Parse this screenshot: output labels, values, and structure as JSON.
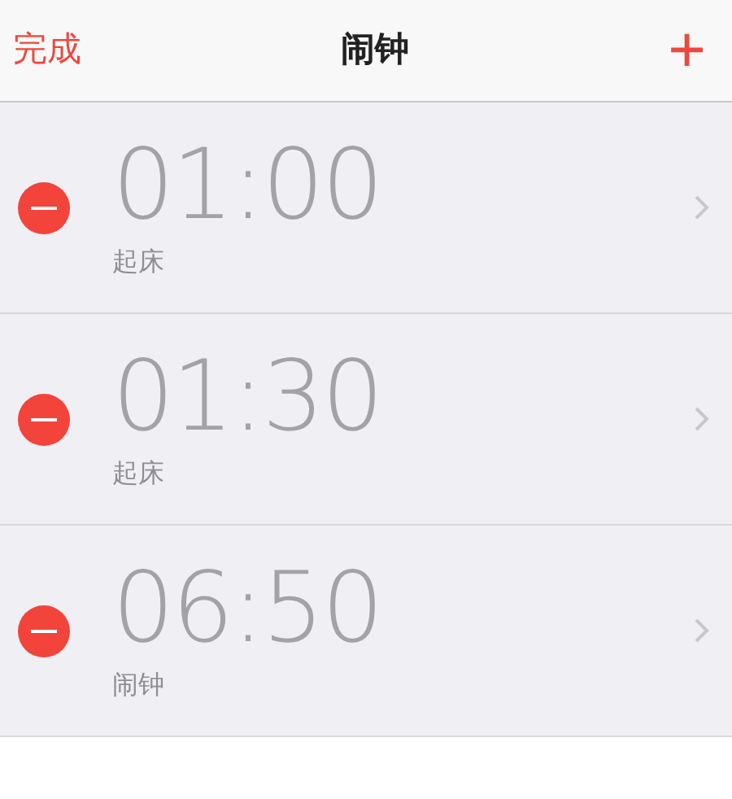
{
  "nav": {
    "left": "完成",
    "title": "闹钟",
    "right": "+"
  },
  "alarms": [
    {
      "time": "01:00",
      "label": "起床"
    },
    {
      "time": "01:30",
      "label": "起床"
    },
    {
      "time": "06:50",
      "label": "闹钟"
    }
  ]
}
